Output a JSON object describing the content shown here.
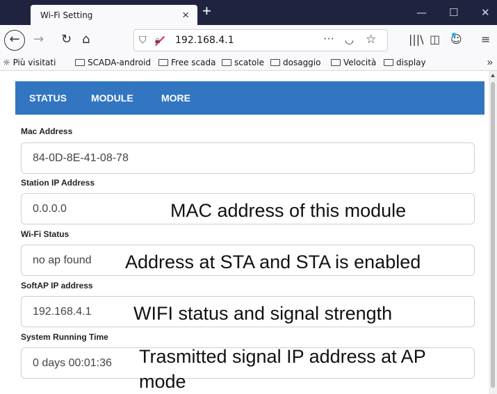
{
  "browser": {
    "tab_title": "Wi-Fi Setting",
    "tab_close": "×",
    "new_tab": "+",
    "win_min": "—",
    "win_max": "☐",
    "win_close": "✕",
    "url": "192.168.4.1",
    "url_more": "···",
    "bookmarks": [
      {
        "label": "Più visitati",
        "icon": "gear-star-icon"
      },
      {
        "label": "SCADA-android",
        "icon": "folder-icon"
      },
      {
        "label": "Free scada",
        "icon": "folder-icon"
      },
      {
        "label": "scatole",
        "icon": "folder-icon"
      },
      {
        "label": "dosaggio",
        "icon": "folder-icon"
      },
      {
        "label": "Velocità",
        "icon": "folder-icon"
      },
      {
        "label": "display",
        "icon": "folder-icon"
      }
    ],
    "bookmarks_overflow": "»"
  },
  "menu": {
    "items": [
      "STATUS",
      "MODULE",
      "MORE"
    ],
    "color": "#3276c2"
  },
  "fields": [
    {
      "label": "Mac Address",
      "value": "84-0D-8E-41-08-78"
    },
    {
      "label": "Station IP Address",
      "value": "0.0.0.0"
    },
    {
      "label": "Wi-Fi Status",
      "value": "no ap found"
    },
    {
      "label": "SoftAP IP address",
      "value": "192.168.4.1"
    },
    {
      "label": "System Running Time",
      "value": "0 days 00:01:36"
    }
  ],
  "annotations": [
    "MAC address of this module",
    "Address at STA and STA is enabled",
    "WIFI status and signal strength",
    "Trasmitted signal IP address at AP",
    "mode"
  ]
}
